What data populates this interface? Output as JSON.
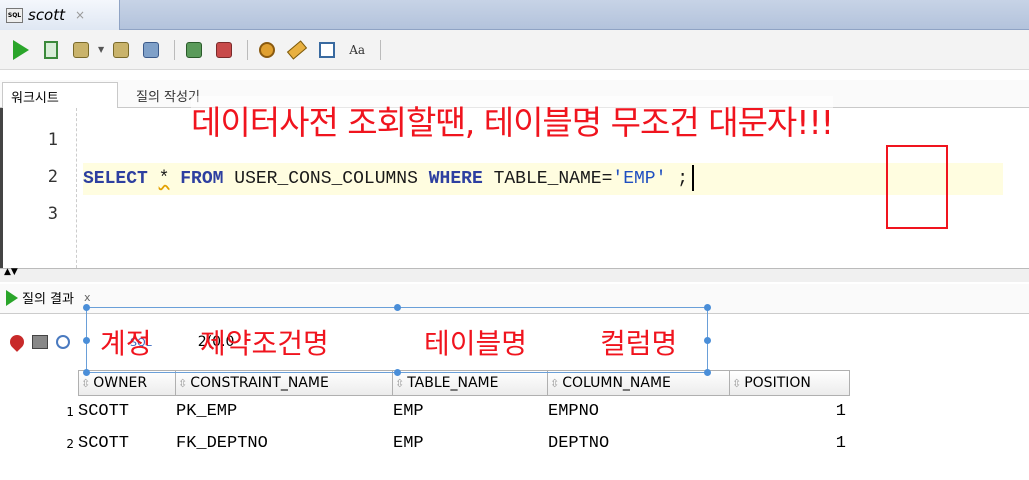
{
  "doc_tab": {
    "title": "scott",
    "close": "×",
    "icon": "sql-file-icon"
  },
  "toolbar": {
    "buttons": [
      "run-statement-icon",
      "run-script-icon",
      "commit-icon",
      "rollback-icon",
      "autotrace-icon",
      "explain-plan-icon",
      "sql-tuning-icon",
      "clear-icon",
      "history-icon",
      "to-upper-icon"
    ]
  },
  "worksheet_tabs": [
    "워크시트",
    "질의 작성기"
  ],
  "editor": {
    "line_numbers": [
      "1",
      "2",
      "3"
    ],
    "code": {
      "select": "SELECT",
      "star": "*",
      "from": "FROM",
      "table": "USER_CONS_COLUMNS",
      "where": "WHERE",
      "column": "TABLE_NAME=",
      "literal": "'EMP'",
      "terminator": " ;"
    }
  },
  "result": {
    "tab_label": "질의 결과",
    "tab_close": "x",
    "sql_label": "SQL",
    "rows_text": "2(0.0",
    "columns": [
      "OWNER",
      "CONSTRAINT_NAME",
      "TABLE_NAME",
      "COLUMN_NAME",
      "POSITION"
    ],
    "rows": [
      {
        "n": "1",
        "owner": "SCOTT",
        "constraint_name": "PK_EMP",
        "table_name": "EMP",
        "column_name": "EMPNO",
        "position": "1"
      },
      {
        "n": "2",
        "owner": "SCOTT",
        "constraint_name": "FK_DEPTNO",
        "table_name": "EMP",
        "column_name": "DEPTNO",
        "position": "1"
      }
    ]
  },
  "annotations": {
    "headline": "데이터사전 조회할땐, 테이블명 무조건 대문자!!!",
    "owner": "계정",
    "constraint": "제약조건명",
    "table": "테이블명",
    "column": "컬럼명",
    "color": "#f0141e"
  }
}
